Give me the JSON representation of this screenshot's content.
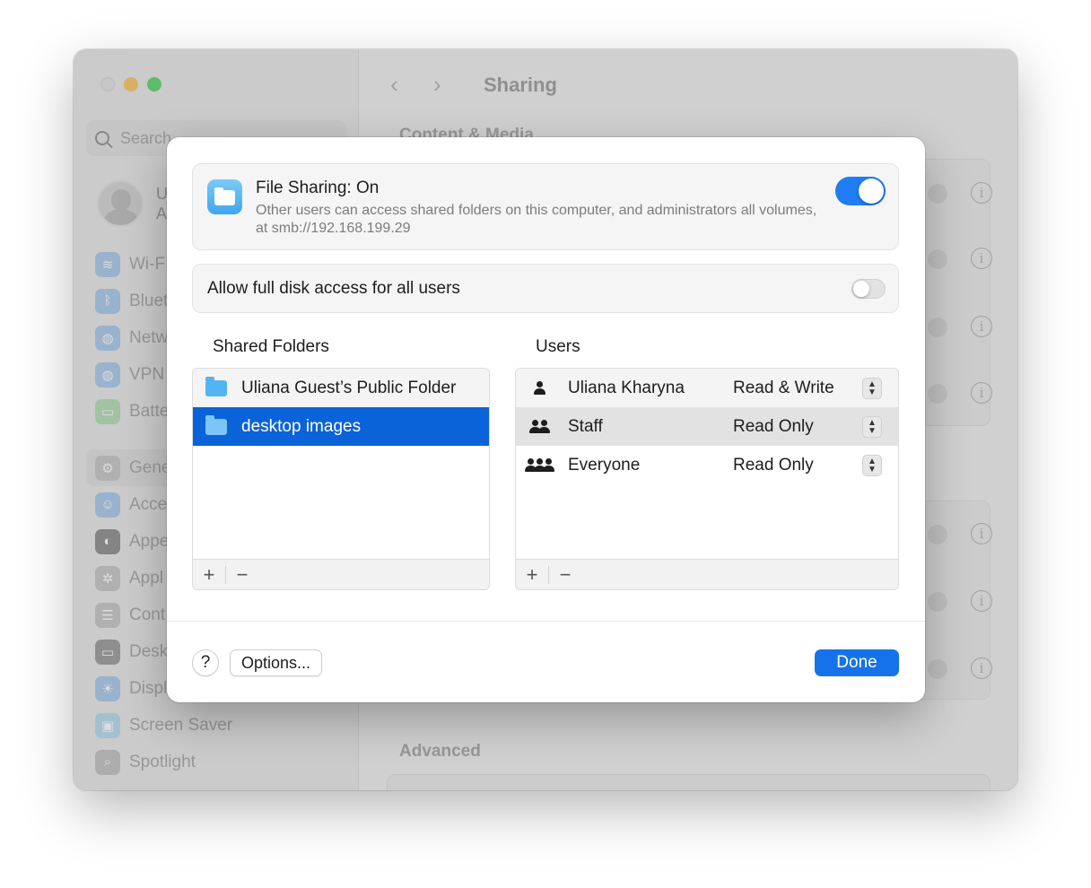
{
  "window": {
    "sidebar": {
      "search_placeholder": "Search",
      "account": {
        "name": "U",
        "subtitle": "A"
      },
      "items_top": [
        {
          "label": "Wi-F",
          "color": "#4a9cf0"
        },
        {
          "label": "Bluet",
          "color": "#4a9cf0"
        },
        {
          "label": "Netw",
          "color": "#4a9cf0"
        },
        {
          "label": "VPN",
          "color": "#4a9cf0"
        },
        {
          "label": "Batte",
          "color": "#5bc35b"
        }
      ],
      "items_bottom": [
        {
          "label": "Gene",
          "color": "#9a9a9a"
        },
        {
          "label": "Acce",
          "color": "#4a9cf0"
        },
        {
          "label": "Appe",
          "color": "#222222"
        },
        {
          "label": "Appl",
          "color": "#9a9a9a"
        },
        {
          "label": "Cont",
          "color": "#9a9a9a"
        },
        {
          "label": "Desk",
          "color": "#333333"
        },
        {
          "label": "Displ",
          "color": "#4a9cf0"
        },
        {
          "label": "Screen Saver",
          "color": "#5fb6e8"
        },
        {
          "label": "Spotlight",
          "color": "#8a8a8a"
        }
      ]
    },
    "main": {
      "nav_back": "‹",
      "nav_forward": "›",
      "title": "Sharing",
      "section_content": "Content & Media",
      "section_advanced": "Advanced"
    }
  },
  "sheet": {
    "file_sharing": {
      "title": "File Sharing: On",
      "description": "Other users can access shared folders on this computer, and administrators all volumes, at smb://192.168.199.29",
      "enabled": true
    },
    "full_disk": {
      "label": "Allow full disk access for all users",
      "enabled": false
    },
    "shared_folders": {
      "title": "Shared Folders",
      "items": [
        {
          "name": "Uliana Guest’s Public Folder"
        },
        {
          "name": "desktop images"
        }
      ],
      "selected_index": 1
    },
    "users": {
      "title": "Users",
      "items": [
        {
          "name": "Uliana Kharyna",
          "permission": "Read & Write",
          "icon": "person-icon"
        },
        {
          "name": "Staff",
          "permission": "Read Only",
          "icon": "group-icon"
        },
        {
          "name": "Everyone",
          "permission": "Read Only",
          "icon": "everyone-icon"
        }
      ],
      "selected_index": 1
    },
    "list_controls": {
      "add": "+",
      "remove": "−"
    },
    "footer": {
      "help": "?",
      "options": "Options...",
      "done": "Done"
    }
  },
  "colors": {
    "accent": "#1672ea",
    "selection": "#0a63d8",
    "folder": "#52b4f1"
  }
}
